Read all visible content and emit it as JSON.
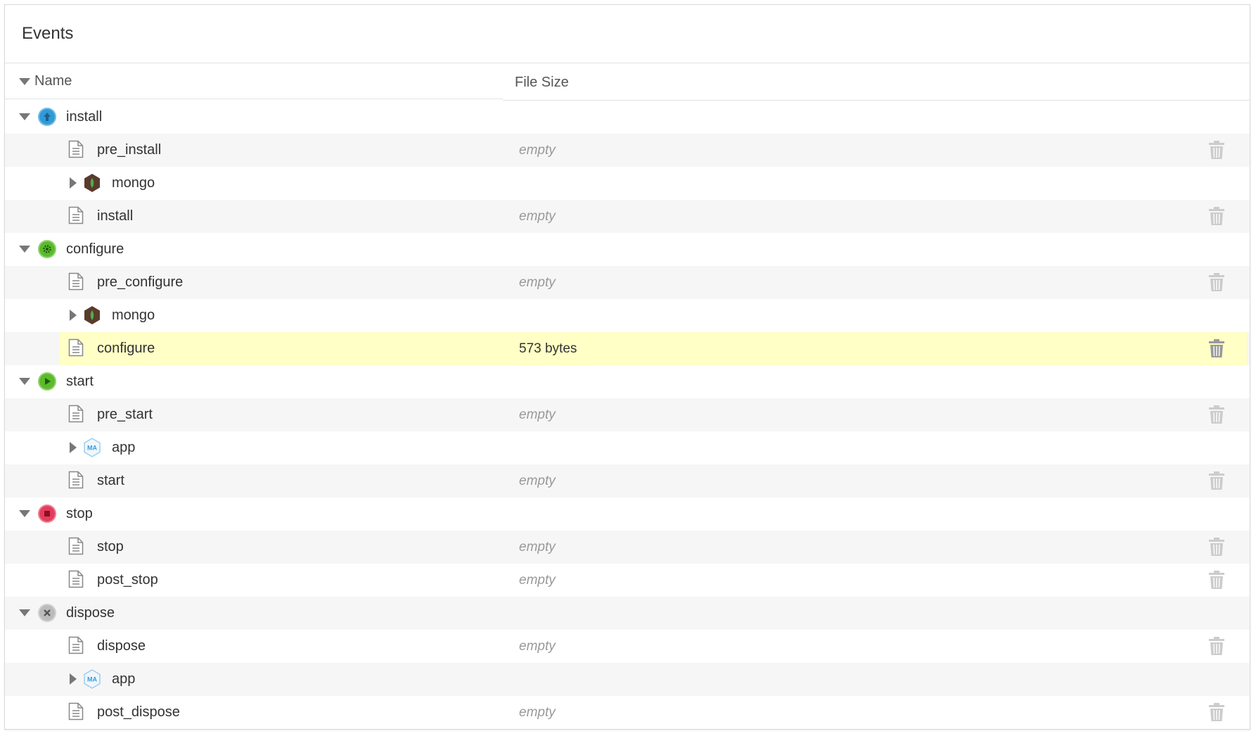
{
  "panel": {
    "title": "Events"
  },
  "columns": {
    "name": "Name",
    "file_size": "File Size"
  },
  "rows": [
    {
      "type": "group",
      "label": "install",
      "icon": "install-icon",
      "color": "#2e9bd8"
    },
    {
      "type": "file",
      "label": "pre_install",
      "size": "empty"
    },
    {
      "type": "node",
      "label": "mongo",
      "icon": "mongo-hex-icon"
    },
    {
      "type": "file",
      "label": "install",
      "size": "empty"
    },
    {
      "type": "group",
      "label": "configure",
      "icon": "configure-gear-icon",
      "color": "#5bbb2a"
    },
    {
      "type": "file",
      "label": "pre_configure",
      "size": "empty"
    },
    {
      "type": "node",
      "label": "mongo",
      "icon": "mongo-hex-icon"
    },
    {
      "type": "file",
      "label": "configure",
      "size": "573 bytes",
      "selected": true
    },
    {
      "type": "group",
      "label": "start",
      "icon": "start-play-icon",
      "color": "#5bbb2a"
    },
    {
      "type": "file",
      "label": "pre_start",
      "size": "empty"
    },
    {
      "type": "node",
      "label": "app",
      "icon": "ma-hex-icon",
      "badge": "MA"
    },
    {
      "type": "file",
      "label": "start",
      "size": "empty"
    },
    {
      "type": "group",
      "label": "stop",
      "icon": "stop-icon",
      "color": "#e43c5c"
    },
    {
      "type": "file",
      "label": "stop",
      "size": "empty"
    },
    {
      "type": "file",
      "label": "post_stop",
      "size": "empty"
    },
    {
      "type": "group",
      "label": "dispose",
      "icon": "dispose-x-icon",
      "color": "#bbbbbb"
    },
    {
      "type": "file",
      "label": "dispose",
      "size": "empty"
    },
    {
      "type": "node",
      "label": "app",
      "icon": "ma-hex-icon",
      "badge": "MA"
    },
    {
      "type": "file",
      "label": "post_dispose",
      "size": "empty"
    }
  ]
}
